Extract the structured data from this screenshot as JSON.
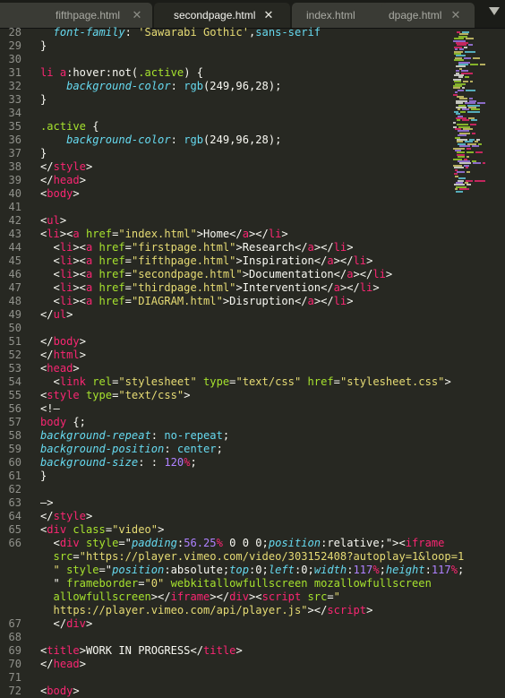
{
  "tabs": [
    {
      "label": "fifthpage.html",
      "active": false
    },
    {
      "label": "secondpage.html",
      "active": true
    },
    {
      "label": "index.html",
      "active": false
    },
    {
      "label": "dpage.html",
      "active": false
    }
  ],
  "close_glyph": "✕",
  "line_numbers": [
    "28",
    "29",
    "30",
    "31",
    "32",
    "33",
    "34",
    "35",
    "36",
    "37",
    "38",
    "39",
    "40",
    "41",
    "42",
    "43",
    "44",
    "45",
    "46",
    "47",
    "48",
    "49",
    "50",
    "51",
    "52",
    "53",
    "54",
    "55",
    "56",
    "57",
    "58",
    "59",
    "60",
    "61",
    "62",
    "63",
    "64",
    "65",
    "66",
    "67",
    "68",
    "69",
    "70",
    "71",
    "72"
  ],
  "code_lines": [
    [
      {
        "c": "p",
        "t": "  font-family"
      },
      {
        "c": "w",
        "t": ": "
      },
      {
        "c": "s",
        "t": "'Sawarabi Gothic'"
      },
      {
        "c": "w",
        "t": ","
      },
      {
        "c": "f",
        "t": "sans-serif"
      }
    ],
    [
      {
        "c": "w",
        "t": "}"
      }
    ],
    [],
    [
      {
        "c": "t",
        "t": "li"
      },
      {
        "c": "w",
        "t": " "
      },
      {
        "c": "t",
        "t": "a"
      },
      {
        "c": "w",
        "t": ":hover:not("
      },
      {
        "c": "a",
        "t": ".active"
      },
      {
        "c": "w",
        "t": ") {"
      }
    ],
    [
      {
        "c": "p",
        "t": "    background-color"
      },
      {
        "c": "w",
        "t": ": "
      },
      {
        "c": "f",
        "t": "rgb"
      },
      {
        "c": "w",
        "t": "(249,96,28);"
      }
    ],
    [
      {
        "c": "w",
        "t": "}"
      }
    ],
    [],
    [
      {
        "c": "a",
        "t": ".active"
      },
      {
        "c": "w",
        "t": " {"
      }
    ],
    [
      {
        "c": "p",
        "t": "    background-color"
      },
      {
        "c": "w",
        "t": ": "
      },
      {
        "c": "f",
        "t": "rgb"
      },
      {
        "c": "w",
        "t": "(249,96,28);"
      }
    ],
    [
      {
        "c": "w",
        "t": "}"
      }
    ],
    [
      {
        "c": "w",
        "t": "</"
      },
      {
        "c": "t",
        "t": "style"
      },
      {
        "c": "w",
        "t": ">"
      }
    ],
    [
      {
        "c": "w",
        "t": "</"
      },
      {
        "c": "t",
        "t": "head"
      },
      {
        "c": "w",
        "t": ">"
      }
    ],
    [
      {
        "c": "w",
        "t": "<"
      },
      {
        "c": "t",
        "t": "body"
      },
      {
        "c": "w",
        "t": ">"
      }
    ],
    [],
    [
      {
        "c": "w",
        "t": "<"
      },
      {
        "c": "t",
        "t": "ul"
      },
      {
        "c": "w",
        "t": ">"
      }
    ],
    [
      {
        "c": "w",
        "t": "<"
      },
      {
        "c": "t",
        "t": "li"
      },
      {
        "c": "w",
        "t": "><"
      },
      {
        "c": "t",
        "t": "a"
      },
      {
        "c": "w",
        "t": " "
      },
      {
        "c": "a",
        "t": "href"
      },
      {
        "c": "w",
        "t": "="
      },
      {
        "c": "s",
        "t": "\"index.html\""
      },
      {
        "c": "w",
        "t": ">Home</"
      },
      {
        "c": "t",
        "t": "a"
      },
      {
        "c": "w",
        "t": "></"
      },
      {
        "c": "t",
        "t": "li"
      },
      {
        "c": "w",
        "t": ">"
      }
    ],
    [
      {
        "c": "w",
        "t": "  <"
      },
      {
        "c": "t",
        "t": "li"
      },
      {
        "c": "w",
        "t": "><"
      },
      {
        "c": "t",
        "t": "a"
      },
      {
        "c": "w",
        "t": " "
      },
      {
        "c": "a",
        "t": "href"
      },
      {
        "c": "w",
        "t": "="
      },
      {
        "c": "s",
        "t": "\"firstpage.html\""
      },
      {
        "c": "w",
        "t": ">Research</"
      },
      {
        "c": "t",
        "t": "a"
      },
      {
        "c": "w",
        "t": "></"
      },
      {
        "c": "t",
        "t": "li"
      },
      {
        "c": "w",
        "t": ">"
      }
    ],
    [
      {
        "c": "w",
        "t": "  <"
      },
      {
        "c": "t",
        "t": "li"
      },
      {
        "c": "w",
        "t": "><"
      },
      {
        "c": "t",
        "t": "a"
      },
      {
        "c": "w",
        "t": " "
      },
      {
        "c": "a",
        "t": "href"
      },
      {
        "c": "w",
        "t": "="
      },
      {
        "c": "s",
        "t": "\"fifthpage.html\""
      },
      {
        "c": "w",
        "t": ">Inspiration</"
      },
      {
        "c": "t",
        "t": "a"
      },
      {
        "c": "w",
        "t": "></"
      },
      {
        "c": "t",
        "t": "li"
      },
      {
        "c": "w",
        "t": ">"
      }
    ],
    [
      {
        "c": "w",
        "t": "  <"
      },
      {
        "c": "t",
        "t": "li"
      },
      {
        "c": "w",
        "t": "><"
      },
      {
        "c": "t",
        "t": "a"
      },
      {
        "c": "w",
        "t": " "
      },
      {
        "c": "a",
        "t": "href"
      },
      {
        "c": "w",
        "t": "="
      },
      {
        "c": "s",
        "t": "\"secondpage.html\""
      },
      {
        "c": "w",
        "t": ">Documentation</"
      },
      {
        "c": "t",
        "t": "a"
      },
      {
        "c": "w",
        "t": "></"
      },
      {
        "c": "t",
        "t": "li"
      },
      {
        "c": "w",
        "t": ">"
      }
    ],
    [
      {
        "c": "w",
        "t": "  <"
      },
      {
        "c": "t",
        "t": "li"
      },
      {
        "c": "w",
        "t": "><"
      },
      {
        "c": "t",
        "t": "a"
      },
      {
        "c": "w",
        "t": " "
      },
      {
        "c": "a",
        "t": "href"
      },
      {
        "c": "w",
        "t": "="
      },
      {
        "c": "s",
        "t": "\"thirdpage.html\""
      },
      {
        "c": "w",
        "t": ">Intervention</"
      },
      {
        "c": "t",
        "t": "a"
      },
      {
        "c": "w",
        "t": "></"
      },
      {
        "c": "t",
        "t": "li"
      },
      {
        "c": "w",
        "t": ">"
      }
    ],
    [
      {
        "c": "w",
        "t": "  <"
      },
      {
        "c": "t",
        "t": "li"
      },
      {
        "c": "w",
        "t": "><"
      },
      {
        "c": "t",
        "t": "a"
      },
      {
        "c": "w",
        "t": " "
      },
      {
        "c": "a",
        "t": "href"
      },
      {
        "c": "w",
        "t": "="
      },
      {
        "c": "s",
        "t": "\"DIAGRAM.html\""
      },
      {
        "c": "w",
        "t": ">Disruption</"
      },
      {
        "c": "t",
        "t": "a"
      },
      {
        "c": "w",
        "t": "></"
      },
      {
        "c": "t",
        "t": "li"
      },
      {
        "c": "w",
        "t": ">"
      }
    ],
    [
      {
        "c": "w",
        "t": "</"
      },
      {
        "c": "t",
        "t": "ul"
      },
      {
        "c": "w",
        "t": ">"
      }
    ],
    [],
    [
      {
        "c": "w",
        "t": "</"
      },
      {
        "c": "t",
        "t": "body"
      },
      {
        "c": "w",
        "t": ">"
      }
    ],
    [
      {
        "c": "w",
        "t": "</"
      },
      {
        "c": "t",
        "t": "html"
      },
      {
        "c": "w",
        "t": ">"
      }
    ],
    [
      {
        "c": "w",
        "t": "<"
      },
      {
        "c": "t",
        "t": "head"
      },
      {
        "c": "w",
        "t": ">"
      }
    ],
    [
      {
        "c": "w",
        "t": "  <"
      },
      {
        "c": "t",
        "t": "link"
      },
      {
        "c": "w",
        "t": " "
      },
      {
        "c": "a",
        "t": "rel"
      },
      {
        "c": "w",
        "t": "="
      },
      {
        "c": "s",
        "t": "\"stylesheet\""
      },
      {
        "c": "w",
        "t": " "
      },
      {
        "c": "a",
        "t": "type"
      },
      {
        "c": "w",
        "t": "="
      },
      {
        "c": "s",
        "t": "\"text/css\""
      },
      {
        "c": "w",
        "t": " "
      },
      {
        "c": "a",
        "t": "href"
      },
      {
        "c": "w",
        "t": "="
      },
      {
        "c": "s",
        "t": "\"stylesheet.css\""
      },
      {
        "c": "w",
        "t": ">"
      }
    ],
    [
      {
        "c": "w",
        "t": "<"
      },
      {
        "c": "t",
        "t": "style"
      },
      {
        "c": "w",
        "t": " "
      },
      {
        "c": "a",
        "t": "type"
      },
      {
        "c": "w",
        "t": "="
      },
      {
        "c": "s",
        "t": "\"text/css\""
      },
      {
        "c": "w",
        "t": ">"
      }
    ],
    [
      {
        "c": "w",
        "t": "<!—"
      }
    ],
    [
      {
        "c": "t",
        "t": "body"
      },
      {
        "c": "w",
        "t": " {;"
      }
    ],
    [
      {
        "c": "p",
        "t": "background-repeat"
      },
      {
        "c": "w",
        "t": ": "
      },
      {
        "c": "f",
        "t": "no-repeat"
      },
      {
        "c": "w",
        "t": ";"
      }
    ],
    [
      {
        "c": "p",
        "t": "background-position"
      },
      {
        "c": "w",
        "t": ": "
      },
      {
        "c": "f",
        "t": "center"
      },
      {
        "c": "w",
        "t": ";"
      }
    ],
    [
      {
        "c": "p",
        "t": "background-size"
      },
      {
        "c": "w",
        "t": ": : "
      },
      {
        "c": "n",
        "t": "120"
      },
      {
        "c": "t",
        "t": "%"
      },
      {
        "c": "w",
        "t": ";"
      }
    ],
    [
      {
        "c": "w",
        "t": "}"
      }
    ],
    [],
    [
      {
        "c": "w",
        "t": "—>"
      }
    ],
    [
      {
        "c": "w",
        "t": "</"
      },
      {
        "c": "t",
        "t": "style"
      },
      {
        "c": "w",
        "t": ">"
      }
    ],
    [
      {
        "c": "w",
        "t": "<"
      },
      {
        "c": "t",
        "t": "div"
      },
      {
        "c": "w",
        "t": " "
      },
      {
        "c": "a",
        "t": "class"
      },
      {
        "c": "w",
        "t": "="
      },
      {
        "c": "s",
        "t": "\"video\""
      },
      {
        "c": "w",
        "t": ">"
      }
    ],
    [
      {
        "c": "w",
        "t": "  <"
      },
      {
        "c": "t",
        "t": "div"
      },
      {
        "c": "w",
        "t": " "
      },
      {
        "c": "a",
        "t": "style"
      },
      {
        "c": "w",
        "t": "=\""
      },
      {
        "c": "p",
        "t": "padding"
      },
      {
        "c": "w",
        "t": ":"
      },
      {
        "c": "n",
        "t": "56.25"
      },
      {
        "c": "t",
        "t": "%"
      },
      {
        "c": "w",
        "t": " 0 0 0;"
      },
      {
        "c": "p",
        "t": "position"
      },
      {
        "c": "w",
        "t": ":relative;\"><"
      },
      {
        "c": "t",
        "t": "iframe"
      }
    ],
    [
      {
        "c": "a",
        "t": "  src"
      },
      {
        "c": "w",
        "t": "="
      },
      {
        "c": "s",
        "t": "\"https://player.vimeo.com/video/303152408?autoplay=1&loop=1"
      }
    ],
    [
      {
        "c": "s",
        "t": "  \""
      },
      {
        "c": "w",
        "t": " "
      },
      {
        "c": "a",
        "t": "style"
      },
      {
        "c": "w",
        "t": "=\""
      },
      {
        "c": "p",
        "t": "position"
      },
      {
        "c": "w",
        "t": ":absolute;"
      },
      {
        "c": "p",
        "t": "top"
      },
      {
        "c": "w",
        "t": ":0;"
      },
      {
        "c": "p",
        "t": "left"
      },
      {
        "c": "w",
        "t": ":0;"
      },
      {
        "c": "p",
        "t": "width"
      },
      {
        "c": "w",
        "t": ":"
      },
      {
        "c": "n",
        "t": "117"
      },
      {
        "c": "t",
        "t": "%"
      },
      {
        "c": "w",
        "t": ";"
      },
      {
        "c": "p",
        "t": "height"
      },
      {
        "c": "w",
        "t": ":"
      },
      {
        "c": "n",
        "t": "117"
      },
      {
        "c": "t",
        "t": "%"
      },
      {
        "c": "w",
        "t": ";"
      }
    ],
    [
      {
        "c": "w",
        "t": "  \" "
      },
      {
        "c": "a",
        "t": "frameborder"
      },
      {
        "c": "w",
        "t": "="
      },
      {
        "c": "s",
        "t": "\"0\""
      },
      {
        "c": "w",
        "t": " "
      },
      {
        "c": "a",
        "t": "webkitallowfullscreen"
      },
      {
        "c": "w",
        "t": " "
      },
      {
        "c": "a",
        "t": "mozallowfullscreen"
      }
    ],
    [
      {
        "c": "a",
        "t": "  allowfullscreen"
      },
      {
        "c": "w",
        "t": "></"
      },
      {
        "c": "t",
        "t": "iframe"
      },
      {
        "c": "w",
        "t": "></"
      },
      {
        "c": "t",
        "t": "div"
      },
      {
        "c": "w",
        "t": "><"
      },
      {
        "c": "t",
        "t": "script"
      },
      {
        "c": "w",
        "t": " "
      },
      {
        "c": "a",
        "t": "src"
      },
      {
        "c": "w",
        "t": "="
      },
      {
        "c": "s",
        "t": "\""
      }
    ],
    [
      {
        "c": "s",
        "t": "  https://player.vimeo.com/api/player.js\""
      },
      {
        "c": "w",
        "t": "></"
      },
      {
        "c": "t",
        "t": "script"
      },
      {
        "c": "w",
        "t": ">"
      }
    ],
    [
      {
        "c": "w",
        "t": "  </"
      },
      {
        "c": "t",
        "t": "div"
      },
      {
        "c": "w",
        "t": ">"
      }
    ],
    [],
    [
      {
        "c": "w",
        "t": "<"
      },
      {
        "c": "t",
        "t": "title"
      },
      {
        "c": "w",
        "t": ">WORK IN PROGRESS</"
      },
      {
        "c": "t",
        "t": "title"
      },
      {
        "c": "w",
        "t": ">"
      }
    ],
    [
      {
        "c": "w",
        "t": "</"
      },
      {
        "c": "t",
        "t": "head"
      },
      {
        "c": "w",
        "t": ">"
      }
    ],
    [],
    [
      {
        "c": "w",
        "t": "<"
      },
      {
        "c": "t",
        "t": "body"
      },
      {
        "c": "w",
        "t": ">"
      }
    ]
  ],
  "gutter_rows": [
    "28",
    "29",
    "30",
    "31",
    "32",
    "33",
    "34",
    "35",
    "36",
    "37",
    "38",
    "39",
    "40",
    "41",
    "42",
    "43",
    "44",
    "45",
    "46",
    "47",
    "48",
    "49",
    "50",
    "51",
    "52",
    "53",
    "54",
    "55",
    "56",
    "57",
    "58",
    "59",
    "60",
    "61",
    "62",
    "63",
    "64",
    "65",
    "66",
    "",
    "",
    "",
    "",
    "",
    "67",
    "68",
    "69",
    "70",
    "71",
    "72"
  ],
  "colors": {
    "background": "#272822",
    "tag": "#f92672",
    "attribute": "#a6e22e",
    "string": "#e6db74",
    "property": "#66d9ef",
    "number": "#ae81ff",
    "text": "#f8f8f2"
  }
}
